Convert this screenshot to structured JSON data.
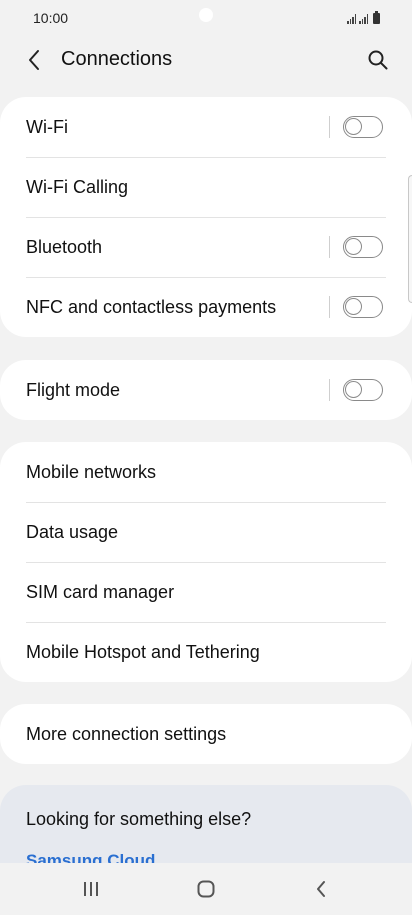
{
  "status_bar": {
    "time": "10:00"
  },
  "header": {
    "title": "Connections"
  },
  "groups": [
    {
      "items": [
        {
          "label": "Wi-Fi",
          "toggle": false
        },
        {
          "label": "Wi-Fi Calling"
        },
        {
          "label": "Bluetooth",
          "toggle": false
        },
        {
          "label": "NFC and contactless payments",
          "toggle": false
        }
      ]
    },
    {
      "items": [
        {
          "label": "Flight mode",
          "toggle": false
        }
      ]
    },
    {
      "items": [
        {
          "label": "Mobile networks"
        },
        {
          "label": "Data usage"
        },
        {
          "label": "SIM card manager"
        },
        {
          "label": "Mobile Hotspot and Tethering"
        }
      ]
    },
    {
      "items": [
        {
          "label": "More connection settings"
        }
      ]
    }
  ],
  "suggestions": {
    "title": "Looking for something else?",
    "link": "Samsung Cloud"
  },
  "colors": {
    "background": "#f2f2f2",
    "card": "#ffffff",
    "toggle_off": "#8a8a8a",
    "link": "#2a6fd1",
    "suggestion_bg": "#e6e9ef"
  },
  "icons": {
    "back": "chevron-left-icon",
    "search": "search-icon",
    "recents": "recents-icon",
    "home": "home-icon",
    "nav_back": "nav-back-icon"
  }
}
